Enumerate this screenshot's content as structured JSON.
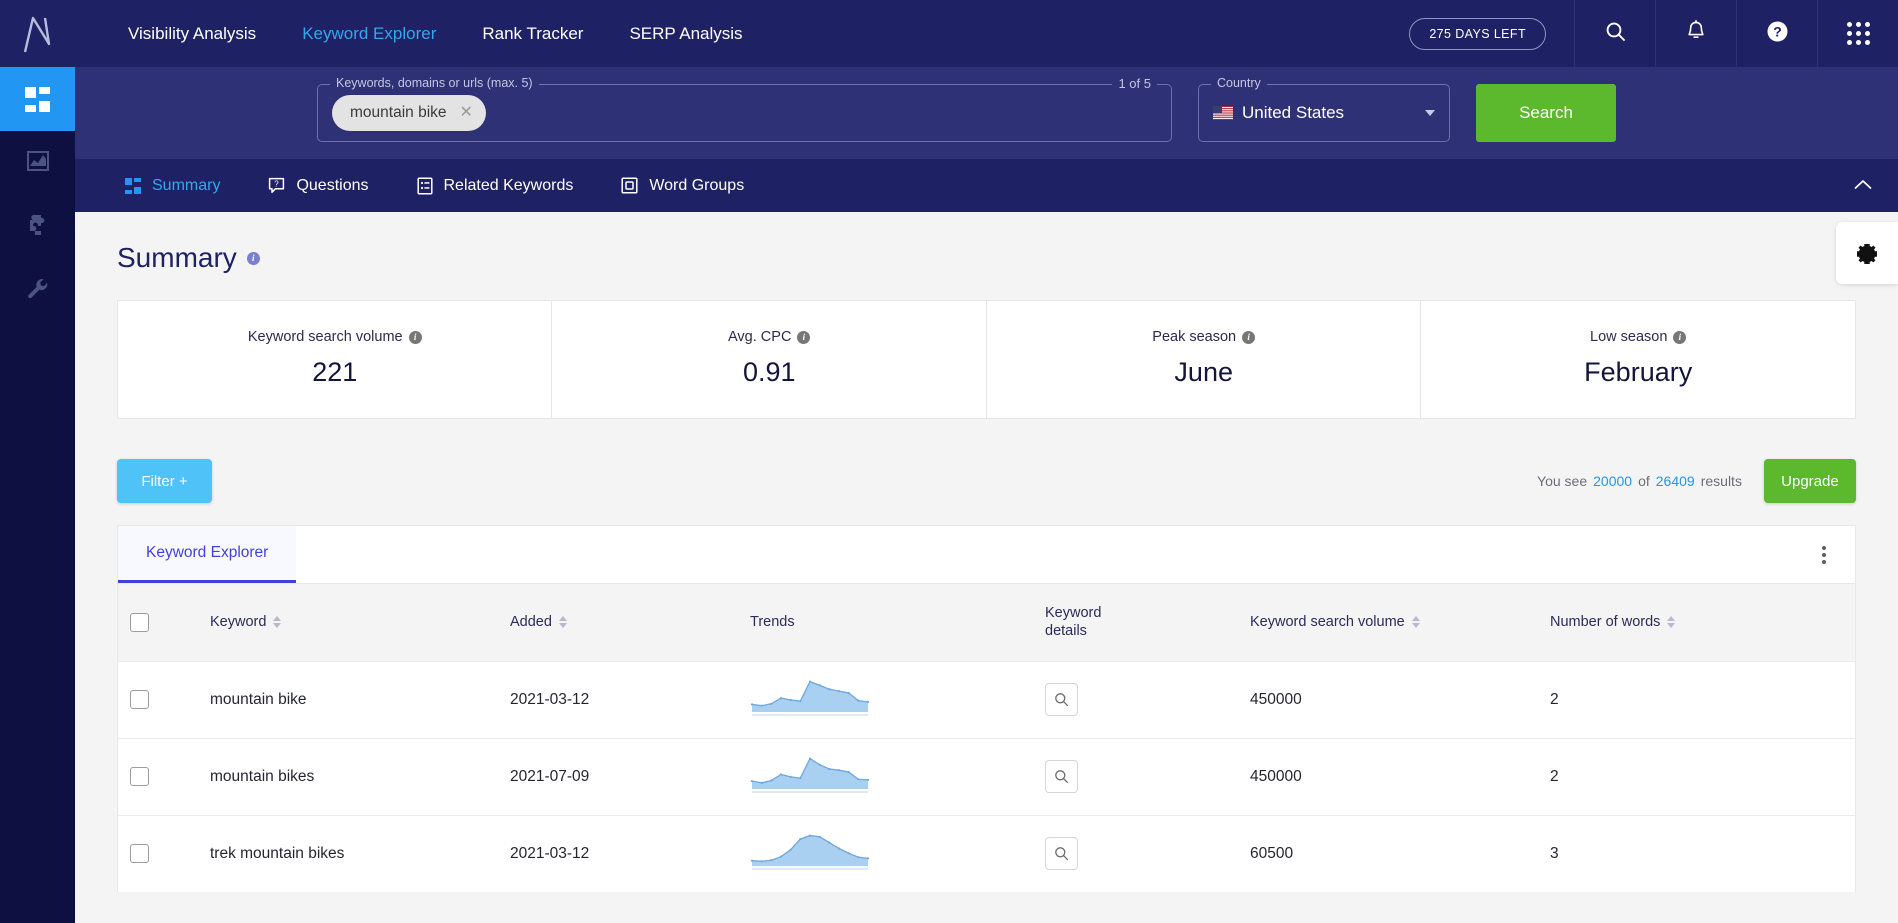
{
  "topnav": {
    "links": [
      {
        "label": "Visibility Analysis",
        "active": false
      },
      {
        "label": "Keyword Explorer",
        "active": true
      },
      {
        "label": "Rank Tracker",
        "active": false
      },
      {
        "label": "SERP Analysis",
        "active": false
      }
    ],
    "days_badge": "275 DAYS LEFT",
    "icons": [
      "search-icon",
      "bell-icon",
      "help-icon",
      "apps-grid-icon"
    ]
  },
  "rail": {
    "items": [
      {
        "name": "dashboard",
        "active": true
      },
      {
        "name": "analytics",
        "active": false
      },
      {
        "name": "integrations",
        "active": false
      },
      {
        "name": "tools",
        "active": false
      }
    ]
  },
  "search": {
    "keywords_legend": "Keywords, domains or urls (max. 5)",
    "count_legend": "1 of 5",
    "chips": [
      {
        "label": "mountain bike"
      }
    ],
    "country_legend": "Country",
    "country_value": "United States",
    "search_button": "Search"
  },
  "tabs": [
    {
      "label": "Summary",
      "icon": "dashboard-tiles-icon",
      "active": true
    },
    {
      "label": "Questions",
      "icon": "question-bubble-icon",
      "active": false
    },
    {
      "label": "Related Keywords",
      "icon": "document-list-icon",
      "active": false
    },
    {
      "label": "Word Groups",
      "icon": "box-group-icon",
      "active": false
    }
  ],
  "page": {
    "title": "Summary",
    "cards": [
      {
        "label": "Keyword search volume",
        "value": "221"
      },
      {
        "label": "Avg. CPC",
        "value": "0.91"
      },
      {
        "label": "Peak season",
        "value": "June"
      },
      {
        "label": "Low season",
        "value": "February"
      }
    ]
  },
  "toolbar": {
    "filter_label": "Filter +",
    "results_prefix": "You see",
    "results_shown": "20000",
    "results_mid": "of",
    "results_total": "26409",
    "results_suffix": "results",
    "upgrade_label": "Upgrade"
  },
  "table": {
    "panel_tab": "Keyword Explorer",
    "columns": [
      {
        "label": "",
        "sortable": false
      },
      {
        "label": "Keyword",
        "sortable": true
      },
      {
        "label": "Added",
        "sortable": true
      },
      {
        "label": "Trends",
        "sortable": false
      },
      {
        "label": "Keyword\ndetails",
        "sortable": false
      },
      {
        "label": "Keyword search volume",
        "sortable": true
      },
      {
        "label": "Number of words",
        "sortable": true
      }
    ],
    "rows": [
      {
        "keyword": "mountain bike",
        "added": "2021-03-12",
        "volume": "450000",
        "words": "2",
        "trend": [
          12,
          10,
          13,
          22,
          19,
          17,
          48,
          42,
          36,
          33,
          30,
          18,
          16
        ]
      },
      {
        "keyword": "mountain bikes",
        "added": "2021-07-09",
        "volume": "450000",
        "words": "2",
        "trend": [
          13,
          10,
          14,
          24,
          20,
          18,
          50,
          40,
          33,
          31,
          28,
          16,
          15
        ]
      },
      {
        "keyword": "trek mountain bikes",
        "added": "2021-03-12",
        "volume": "60500",
        "words": "3",
        "trend": [
          9,
          8,
          10,
          16,
          28,
          46,
          52,
          50,
          40,
          30,
          22,
          15,
          13
        ]
      }
    ]
  },
  "colors": {
    "navy": "#1e2163",
    "band": "#2e3175",
    "rail": "#0e1041",
    "accent_blue": "#2196f3",
    "green": "#5cb82d",
    "filter_blue": "#4fc3f7",
    "tab_blue": "#4141e0",
    "spark_fill": "#a9d0f0",
    "spark_line": "#6fa8dc"
  }
}
